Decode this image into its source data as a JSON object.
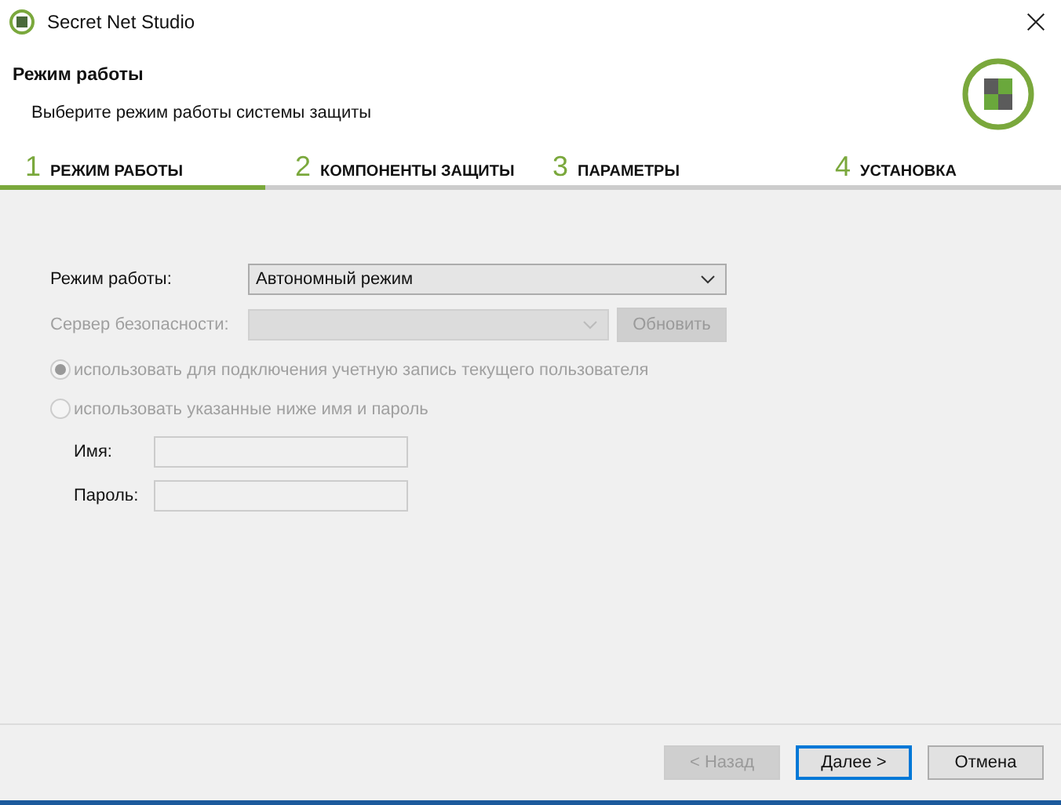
{
  "window": {
    "title": "Secret Net Studio"
  },
  "header": {
    "title": "Режим работы",
    "subtitle": "Выберите режим работы системы защиты"
  },
  "steps": [
    {
      "number": "1",
      "label": "РЕЖИМ РАБОТЫ"
    },
    {
      "number": "2",
      "label": "КОМПОНЕНТЫ ЗАЩИТЫ"
    },
    {
      "number": "3",
      "label": "ПАРАМЕТРЫ"
    },
    {
      "number": "4",
      "label": "УСТАНОВКА"
    }
  ],
  "progress": {
    "level": 0.25
  },
  "mode": {
    "label": "Режим работы:",
    "value": "Автономный режим"
  },
  "server": {
    "label": "Сервер безопасности:",
    "disabled": true,
    "refresh_button": "Обновить"
  },
  "radios": [
    {
      "label": "использовать для подключения учетную запись текущего пользователя",
      "selected": true,
      "disabled": true
    },
    {
      "label": "использовать указанные ниже имя и пароль",
      "selected": false,
      "disabled": true
    }
  ],
  "credentials": [
    {
      "label": "Имя:",
      "disabled": true
    },
    {
      "label": "Пароль:",
      "disabled": true
    }
  ],
  "buttons": [
    {
      "label": "< Назад",
      "disabled": true,
      "default": false
    },
    {
      "label": "Далее >",
      "disabled": false,
      "default": true
    },
    {
      "label": "Отмена",
      "disabled": false,
      "default": false
    }
  ]
}
